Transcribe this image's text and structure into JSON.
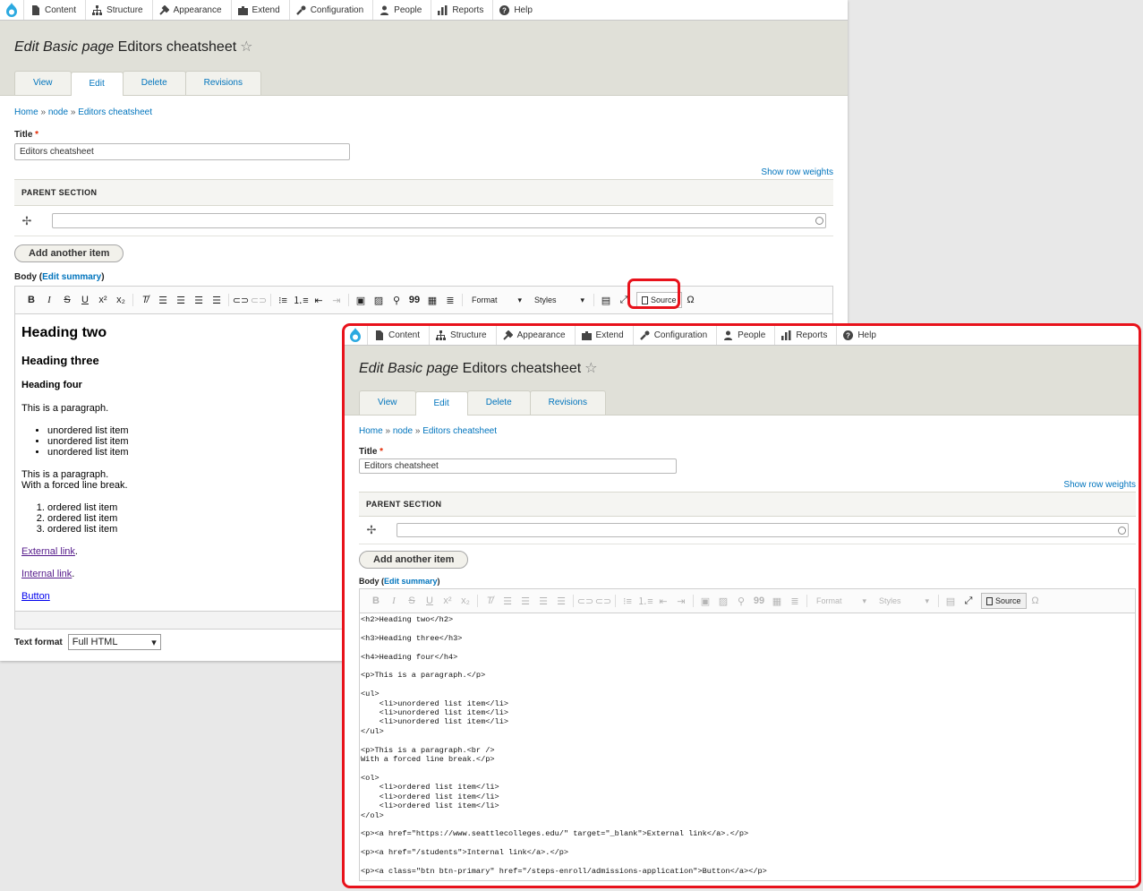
{
  "toolbar": {
    "items": [
      {
        "label": "Content",
        "icon": "content-icon"
      },
      {
        "label": "Structure",
        "icon": "structure-icon"
      },
      {
        "label": "Appearance",
        "icon": "appearance-icon"
      },
      {
        "label": "Extend",
        "icon": "extend-icon"
      },
      {
        "label": "Configuration",
        "icon": "configuration-icon"
      },
      {
        "label": "People",
        "icon": "people-icon"
      },
      {
        "label": "Reports",
        "icon": "reports-icon"
      },
      {
        "label": "Help",
        "icon": "help-icon"
      }
    ]
  },
  "page": {
    "title_type": "Edit Basic page",
    "title_name": "Editors cheatsheet",
    "tabs": [
      "View",
      "Edit",
      "Delete",
      "Revisions"
    ],
    "active_tab": "Edit"
  },
  "breadcrumb": {
    "home": "Home",
    "node": "node",
    "current": "Editors cheatsheet",
    "sep": "»"
  },
  "form": {
    "title_label": "Title",
    "required_mark": "*",
    "title_value": "Editors cheatsheet",
    "row_weights": "Show row weights",
    "parent_section": "PARENT SECTION",
    "add_item": "Add another item",
    "body_label": "Body",
    "edit_summary": "Edit summary",
    "text_format_label": "Text format",
    "text_format_value": "Full HTML"
  },
  "editor_toolbar": {
    "format": "Format",
    "styles": "Styles",
    "source": "Source"
  },
  "wysiwyg": {
    "h2": "Heading two",
    "h3": "Heading three",
    "h4": "Heading four",
    "p1": "This is a paragraph.",
    "ul": [
      "unordered list item",
      "unordered list item",
      "unordered list item"
    ],
    "p2_line1": "This is a paragraph.",
    "p2_line2": "With a forced line break.",
    "ol": [
      "ordered list item",
      "ordered list item",
      "ordered list item"
    ],
    "link_external": "External link",
    "link_internal": "Internal link",
    "link_button": "Button",
    "period": "."
  },
  "source_code": "<h2>Heading two</h2>\n\n<h3>Heading three</h3>\n\n<h4>Heading four</h4>\n\n<p>This is a paragraph.</p>\n\n<ul>\n    <li>unordered list item</li>\n    <li>unordered list item</li>\n    <li>unordered list item</li>\n</ul>\n\n<p>This is a paragraph.<br />\nWith a forced line break.</p>\n\n<ol>\n    <li>ordered list item</li>\n    <li>ordered list item</li>\n    <li>ordered list item</li>\n</ol>\n\n<p><a href=\"https://www.seattlecolleges.edu/\" target=\"_blank\">External link</a>.</p>\n\n<p><a href=\"/students\">Internal link</a>.</p>\n\n<p><a class=\"btn btn-primary\" href=\"/steps-enroll/admissions-application\">Button</a></p>",
  "colors": {
    "highlight": "#e8121b",
    "link": "#0074bd",
    "header_bg": "#e0e0d8"
  }
}
